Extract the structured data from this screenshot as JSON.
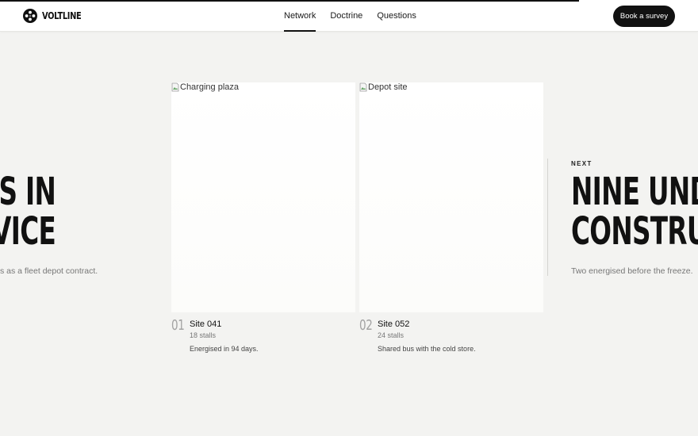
{
  "brand": {
    "name": "VOLTLINE",
    "logo_icon": "film-reel-icon"
  },
  "nav": {
    "items": [
      {
        "label": "Network",
        "active": true
      },
      {
        "label": "Doctrine",
        "active": false
      },
      {
        "label": "Questions",
        "active": false
      }
    ]
  },
  "cta": {
    "label": "Book a survey"
  },
  "scroll_progress": 0.83,
  "previous_slide": {
    "title_lines": [
      "ES IN",
      "VICE"
    ],
    "subtitle": "s as a fleet depot contract."
  },
  "cards": [
    {
      "number": "01",
      "image_alt": "Charging plaza",
      "title": "Site 041",
      "stalls": "18 stalls",
      "note": "Energised in 94 days."
    },
    {
      "number": "02",
      "image_alt": "Depot site",
      "title": "Site 052",
      "stalls": "24 stalls",
      "note": "Shared bus with the cold store."
    }
  ],
  "next_slide": {
    "eyebrow": "NEXT",
    "title_lines": [
      "NINE UND",
      "CONSTRU"
    ],
    "subtitle": "Two energised before the freeze."
  },
  "colors": {
    "background": "#f3f3f1",
    "ink": "#111111",
    "muted": "#777777"
  }
}
